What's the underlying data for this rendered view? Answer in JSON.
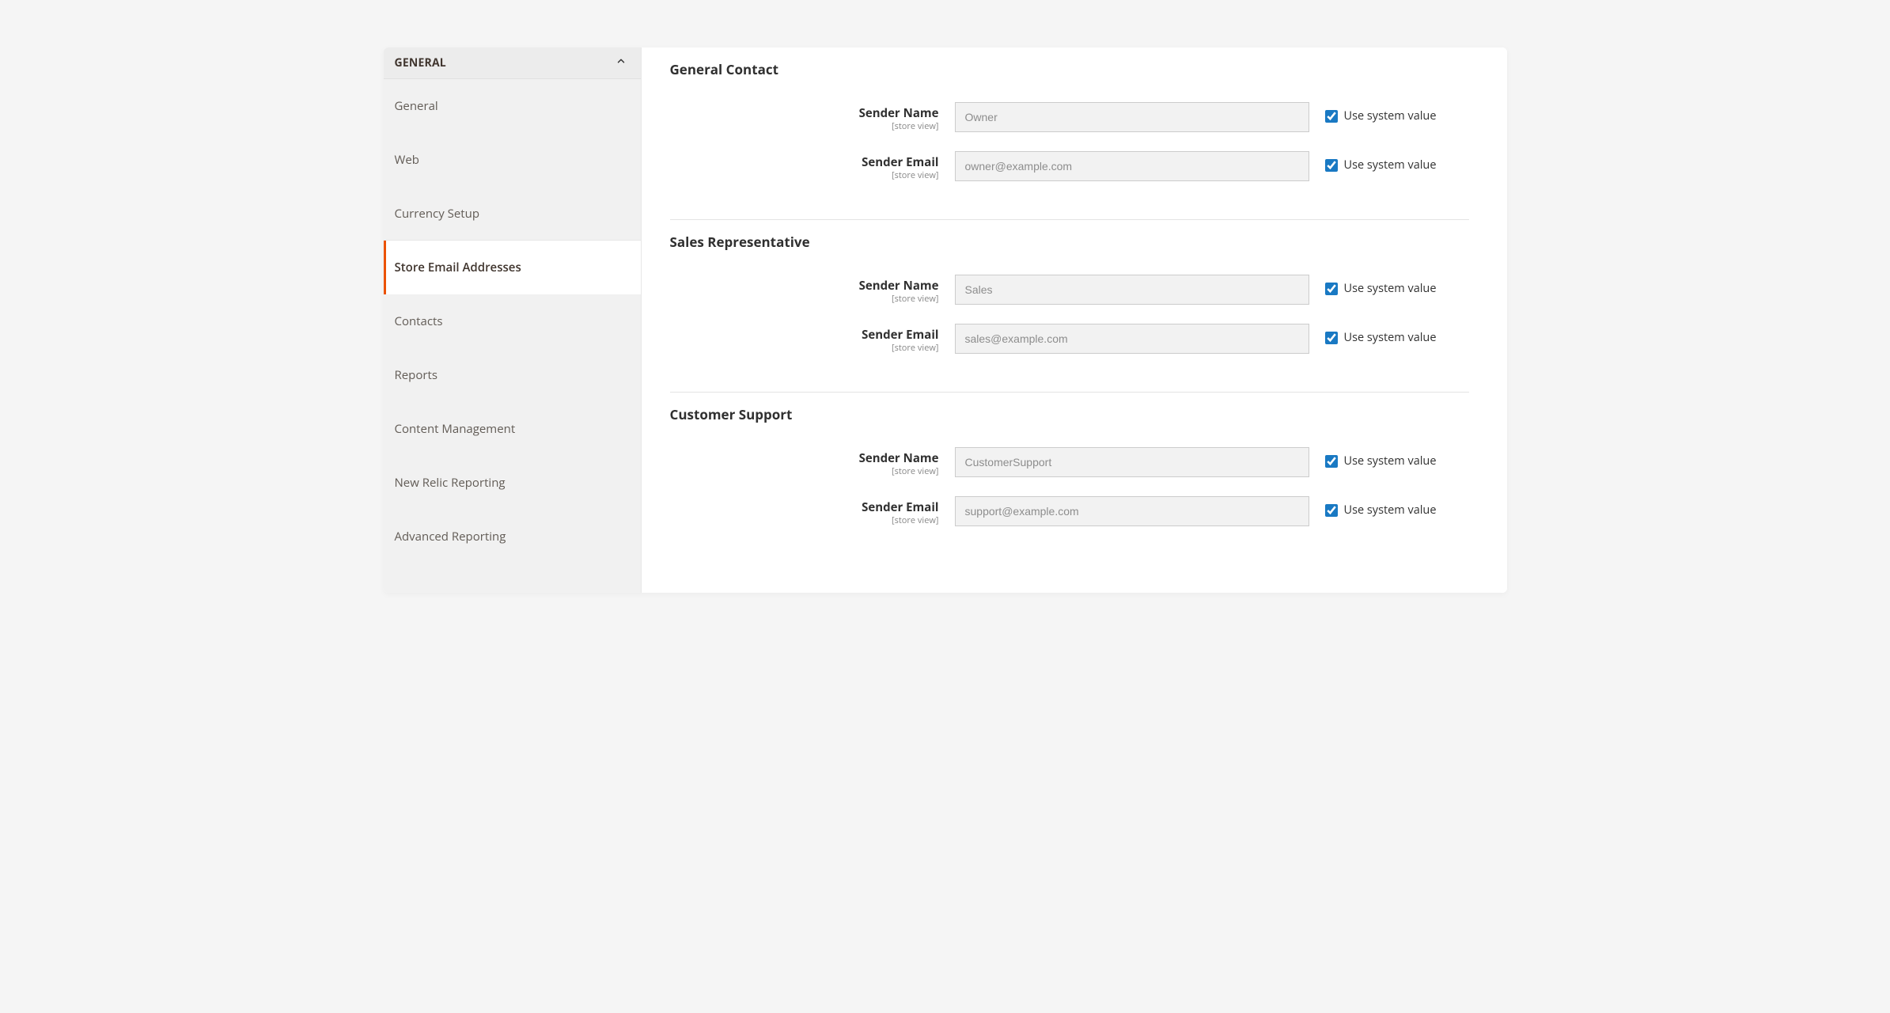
{
  "sidebar": {
    "header": "GENERAL",
    "items": [
      {
        "label": "General",
        "active": false
      },
      {
        "label": "Web",
        "active": false
      },
      {
        "label": "Currency Setup",
        "active": false
      },
      {
        "label": "Store Email Addresses",
        "active": true
      },
      {
        "label": "Contacts",
        "active": false
      },
      {
        "label": "Reports",
        "active": false
      },
      {
        "label": "Content Management",
        "active": false
      },
      {
        "label": "New Relic Reporting",
        "active": false
      },
      {
        "label": "Advanced Reporting",
        "active": false
      }
    ]
  },
  "labels": {
    "sender_name": "Sender Name",
    "sender_email": "Sender Email",
    "scope": "[store view]",
    "use_system_value": "Use system value"
  },
  "sections": [
    {
      "title": "General Contact",
      "name_value": "Owner",
      "email_value": "owner@example.com",
      "name_sysval": true,
      "email_sysval": true
    },
    {
      "title": "Sales Representative",
      "name_value": "Sales",
      "email_value": "sales@example.com",
      "name_sysval": true,
      "email_sysval": true
    },
    {
      "title": "Customer Support",
      "name_value": "CustomerSupport",
      "email_value": "support@example.com",
      "name_sysval": true,
      "email_sysval": true
    }
  ]
}
